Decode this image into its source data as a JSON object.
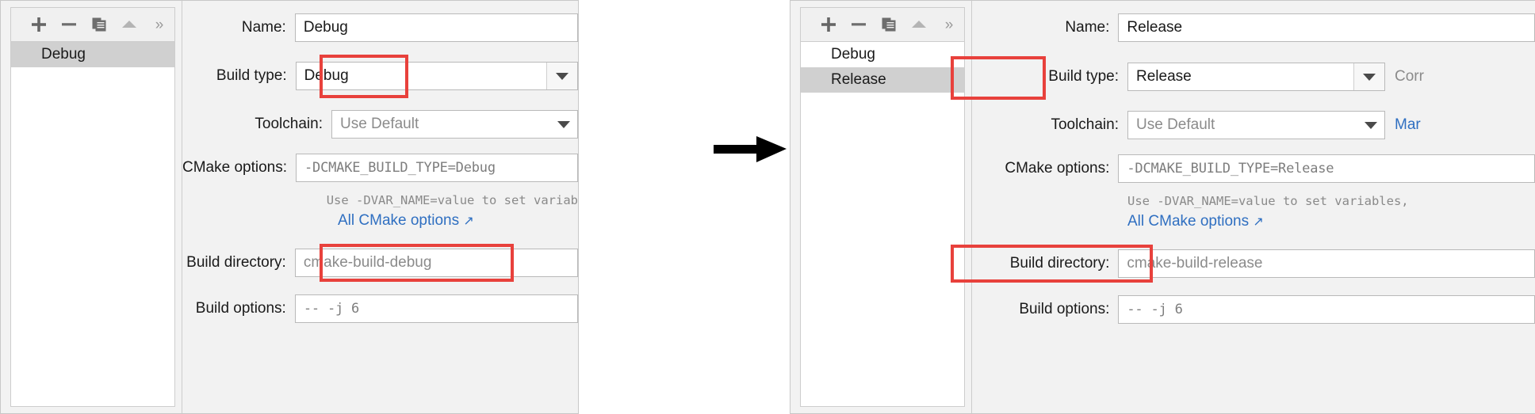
{
  "panels": [
    {
      "id": "debug",
      "toolbar": {
        "buttons": [
          {
            "name": "add-button",
            "icon": "plus-icon"
          },
          {
            "name": "remove-button",
            "icon": "minus-icon"
          },
          {
            "name": "copy-button",
            "icon": "copy-icon"
          },
          {
            "name": "move-up-button",
            "icon": "triangle-up-icon"
          },
          {
            "name": "more-button",
            "icon": "chevron-double-right-icon",
            "glyph": "»"
          }
        ]
      },
      "list": {
        "items": [
          {
            "label": "Debug",
            "selected": true
          }
        ]
      },
      "form": {
        "name_label": "Name:",
        "name_value": "Debug",
        "build_type_label": "Build type:",
        "build_type_value": "Debug",
        "toolchain_label": "Toolchain:",
        "toolchain_value": "Use Default",
        "cmake_options_label": "CMake options:",
        "cmake_options_value": "-DCMAKE_BUILD_TYPE=Debug",
        "hint_text": "Use -DVAR_NAME=value to set variab",
        "all_options_link": "All CMake options",
        "all_options_arrow": "↗",
        "build_dir_label": "Build directory:",
        "build_dir_value": "cmake-build-debug",
        "build_options_label": "Build options:",
        "build_options_value": "--  -j  6"
      }
    },
    {
      "id": "release",
      "toolbar": {
        "buttons": [
          {
            "name": "add-button",
            "icon": "plus-icon"
          },
          {
            "name": "remove-button",
            "icon": "minus-icon"
          },
          {
            "name": "copy-button",
            "icon": "copy-icon"
          },
          {
            "name": "move-up-button",
            "icon": "triangle-up-icon"
          },
          {
            "name": "more-button",
            "icon": "chevron-double-right-icon",
            "glyph": "»"
          }
        ]
      },
      "list": {
        "items": [
          {
            "label": "Debug",
            "selected": false
          },
          {
            "label": "Release",
            "selected": true
          }
        ]
      },
      "form": {
        "name_label": "Name:",
        "name_value": "Release",
        "build_type_label": "Build type:",
        "build_type_value": "Release",
        "build_type_side_note": "Corr",
        "toolchain_label": "Toolchain:",
        "toolchain_value": "Use Default",
        "toolchain_side_link": "Mar",
        "cmake_options_label": "CMake options:",
        "cmake_options_value": "-DCMAKE_BUILD_TYPE=Release",
        "hint_text": "Use -DVAR_NAME=value to set variables,",
        "all_options_link": "All CMake options",
        "all_options_arrow": "↗",
        "build_dir_label": "Build directory:",
        "build_dir_value": "cmake-build-release",
        "build_options_label": "Build options:",
        "build_options_value": "--  -j  6"
      }
    }
  ],
  "flow": {
    "arrow_name": "flow-arrow-right"
  },
  "colors": {
    "highlight": "#e8413c",
    "link": "#2f6fc1",
    "panel_bg": "#f2f2f2",
    "selected_row": "#d0d0d0"
  }
}
